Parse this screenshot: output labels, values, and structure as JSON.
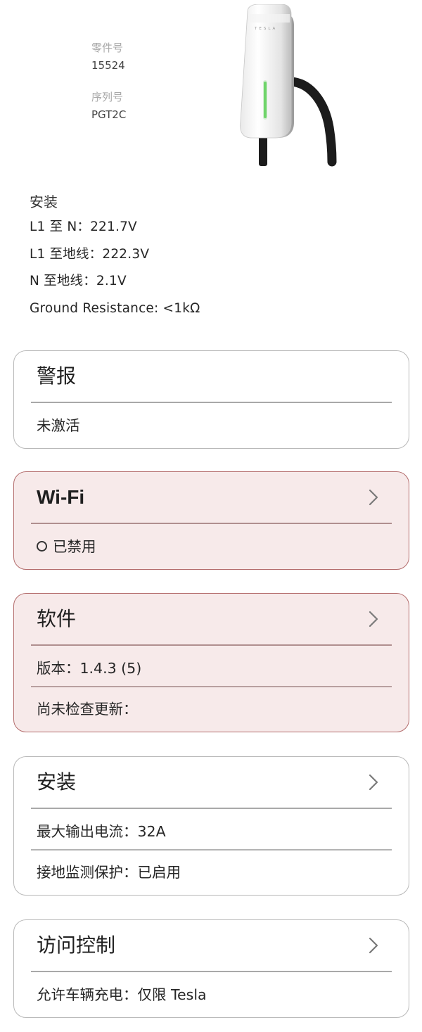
{
  "device": {
    "part_number_label": "零件号",
    "part_number_value": "15524",
    "serial_number_label": "序列号",
    "serial_number_value": "PGT2C",
    "brand_text": "TESLA"
  },
  "install_info": {
    "title": "安装",
    "lines": [
      "L1 至 N：221.7V",
      "L1 至地线：222.3V",
      "N 至地线：2.1V",
      "Ground Resistance: <1kΩ"
    ]
  },
  "cards": {
    "alerts": {
      "title": "警报",
      "status": "未激活"
    },
    "wifi": {
      "title": "Wi-Fi",
      "status": "已禁用"
    },
    "software": {
      "title": "软件",
      "version": "版本：1.4.3 (5)",
      "update_check": "尚未检查更新："
    },
    "installation": {
      "title": "安装",
      "max_current": "最大输出电流：32A",
      "ground_monitoring": "接地监测保护：已启用"
    },
    "access_control": {
      "title": "访问控制",
      "allowed_vehicles": "允许车辆充电：仅限 Tesla"
    }
  },
  "colors": {
    "warn_background": "#f7eaea",
    "warn_border": "#b46d6d",
    "normal_border": "#b9b9b9",
    "led_green": "#6fd46a"
  },
  "icons": {
    "chevron": "chevron-right-icon",
    "status_dot": "circle-outline-icon"
  }
}
